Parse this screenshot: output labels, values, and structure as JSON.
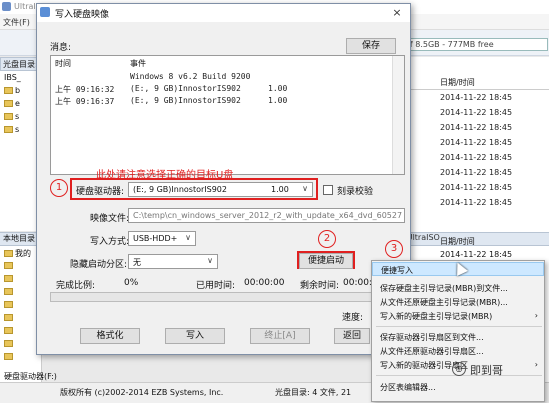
{
  "background": {
    "title": "UltraISO - C:\\temp\\cn_windows_server_2012_r2_with_update_x64_dvd_6052725.iso",
    "menu_file": "文件(F)",
    "size_box": "of 8.5GB - 777MB free",
    "left_header": "光盘目录:",
    "tree_items": [
      "IBS_",
      "b",
      "e",
      "s",
      "s"
    ],
    "right_header": "日期/时间",
    "right_dates": [
      "2014-11-22 18:45",
      "2014-11-22 18:45",
      "2014-11-22 18:45",
      "2014-11-22 18:45",
      "2014-11-22 18:45",
      "2014-11-22 18:45",
      "2014-11-22 18:45",
      "2014-11-22 18:45"
    ],
    "lower_left_label": "本地目录",
    "lower_path": "\\Temp\\UltraISO",
    "lower_tree_items": [
      "我的",
      "",
      "",
      "",
      "",
      "",
      "",
      "",
      "",
      "硬盘驱动器(F:)"
    ],
    "lower_right_header": "日期/时间",
    "lower_right_date": "2014-11-22 18:45",
    "status_left": "版权所有 (c)2002-2014 EZB Systems, Inc.",
    "status_mid": "光盘目录: 4 文件, 21"
  },
  "dialog": {
    "title": "写入硬盘映像",
    "close": "×",
    "message_label": "消息:",
    "save_button": "保存",
    "log_headers": {
      "time": "时间",
      "event": "事件"
    },
    "log_lines": [
      {
        "time": "",
        "event": "Windows 8 v6.2 Build 9200",
        "size": ""
      },
      {
        "time": "上午 09:16:32",
        "event": "(E:, 9 GB)InnostorIS902",
        "size": "1.00"
      },
      {
        "time": "上午 09:16:37",
        "event": "(E:, 9 GB)InnostorIS902",
        "size": "1.00"
      }
    ],
    "red_note": "此处请注意选择正确的目标U盘",
    "annotations": [
      "1",
      "2",
      "3"
    ],
    "disk_label": "硬盘驱动器:",
    "disk_value": "(E:, 9 GB)InnostorIS902",
    "disk_size": "1.00",
    "verify_label": "刻录校验",
    "image_label": "映像文件:",
    "image_value": "C:\\temp\\cn_windows_server_2012_r2_with_update_x64_dvd_60527",
    "write_mode_label": "写入方式:",
    "write_mode_value": "USB-HDD+",
    "hidden_partition_label": "隐藏启动分区:",
    "hidden_partition_value": "无",
    "boot_button": "便捷启动",
    "complete_label": "完成比例:",
    "complete_value": "0%",
    "elapsed_label": "已用时间:",
    "elapsed_value": "00:00:00",
    "remaining_label": "剩余时间:",
    "remaining_value": "00:00:00",
    "speed_label": "速度:",
    "progress_fraction": 0,
    "buttons": {
      "format": "格式化",
      "write": "写入",
      "stop": "终止[A]",
      "back": "返回"
    }
  },
  "context_menu": {
    "items": [
      {
        "label": "便捷写入",
        "submenu": false
      },
      {
        "label": "保存硬盘主引导记录(MBR)到文件...",
        "submenu": false
      },
      {
        "label": "从文件还原硬盘主引导记录(MBR)...",
        "submenu": false
      },
      {
        "label": "写入新的硬盘主引导记录(MBR)",
        "submenu": true
      },
      {
        "label": "保存驱动器引导扇区到文件...",
        "submenu": false
      },
      {
        "label": "从文件还原驱动器引导扇区...",
        "submenu": false
      },
      {
        "label": "写入新的驱动器引导扇区",
        "submenu": true
      },
      {
        "label": "分区表编辑器...",
        "submenu": false
      }
    ]
  },
  "watermark": "即到哥"
}
